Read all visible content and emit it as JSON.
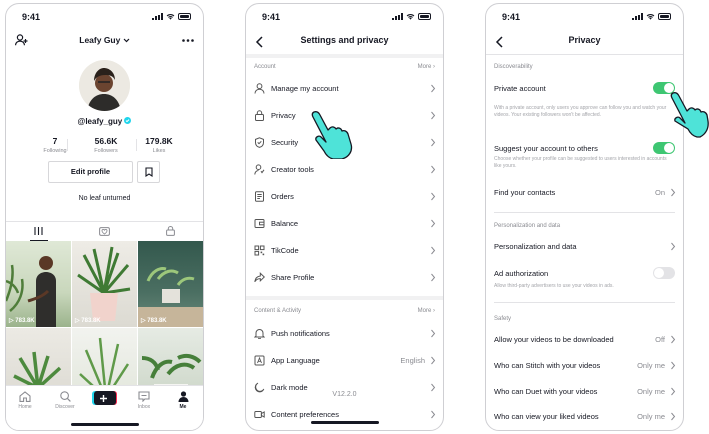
{
  "status_time": "9:41",
  "profile": {
    "username": "Leafy Guy",
    "handle": "@leafy_guy",
    "stats": [
      {
        "value": "7",
        "label": "Following"
      },
      {
        "value": "56.6K",
        "label": "Followers"
      },
      {
        "value": "179.8K",
        "label": "Likes"
      }
    ],
    "edit_label": "Edit profile",
    "bio": "No leaf unturned",
    "videos": [
      {
        "views": "783.8K"
      },
      {
        "views": "783.8K"
      },
      {
        "views": "783.8K"
      },
      {
        "views": ""
      },
      {
        "views": ""
      },
      {
        "views": ""
      }
    ],
    "tabbar": [
      {
        "label": "Home"
      },
      {
        "label": "Discover"
      },
      {
        "label": ""
      },
      {
        "label": "Inbox"
      },
      {
        "label": "Me"
      }
    ]
  },
  "settings": {
    "title": "Settings and privacy",
    "account_section": "Account",
    "more_label": "More",
    "account_items": [
      {
        "label": "Manage my account",
        "icon": "person-icon"
      },
      {
        "label": "Privacy",
        "icon": "lock-icon"
      },
      {
        "label": "Security",
        "icon": "shield-icon"
      },
      {
        "label": "Creator tools",
        "icon": "creator-icon"
      },
      {
        "label": "Orders",
        "icon": "orders-icon"
      },
      {
        "label": "Balance",
        "icon": "wallet-icon"
      },
      {
        "label": "TikCode",
        "icon": "qr-icon"
      },
      {
        "label": "Share Profile",
        "icon": "share-icon"
      }
    ],
    "content_section": "Content & Activity",
    "content_items": [
      {
        "label": "Push notifications",
        "icon": "bell-icon",
        "value": ""
      },
      {
        "label": "App Language",
        "icon": "language-icon",
        "value": "English"
      },
      {
        "label": "Dark mode",
        "icon": "moon-icon",
        "value": ""
      },
      {
        "label": "Content preferences",
        "icon": "video-icon",
        "value": ""
      }
    ],
    "version": "V12.2.0"
  },
  "privacy": {
    "title": "Privacy",
    "discoverability": "Discoverability",
    "private_account": "Private account",
    "private_desc": "With a private account, only users you approve can follow you and watch your videos. Your existing followers won't be affected.",
    "suggest_label": "Suggest your account to others",
    "suggest_desc": "Choose whether your profile can be suggested to users interested in accounts like yours.",
    "find_contacts": "Find your contacts",
    "find_contacts_value": "On",
    "personalization_section": "Personalization and data",
    "personalization_item": "Personalization and data",
    "ad_label": "Ad authorization",
    "ad_desc": "Allow third-party advertisers to use your videos in ads.",
    "safety_section": "Safety",
    "safety_items": [
      {
        "label": "Allow your videos to be downloaded",
        "value": "Off"
      },
      {
        "label": "Who can Stitch with your videos",
        "value": "Only me"
      },
      {
        "label": "Who can Duet with your videos",
        "value": "Only me"
      },
      {
        "label": "Who can view your liked videos",
        "value": "Only me"
      }
    ],
    "toggles": {
      "private_account": true,
      "suggest_account": true,
      "ad_authorization": false
    }
  },
  "colors": {
    "accent": "#fe2c55",
    "toggle_on": "#3ec672",
    "hand": "#4ee3d8",
    "verified": "#20d5ec"
  }
}
